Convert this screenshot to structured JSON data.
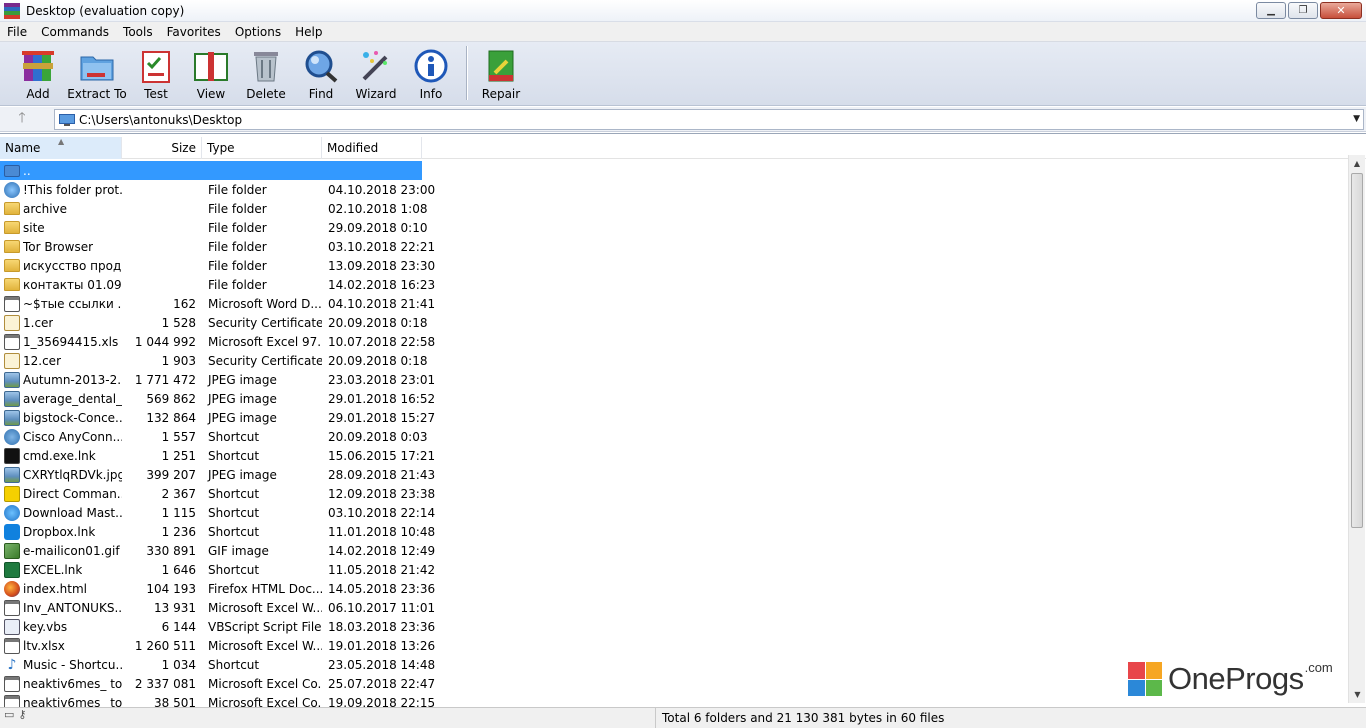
{
  "window": {
    "title": "Desktop (evaluation copy)"
  },
  "menu": [
    "File",
    "Commands",
    "Tools",
    "Favorites",
    "Options",
    "Help"
  ],
  "toolbar": [
    {
      "label": "Add",
      "icon": "add-icon"
    },
    {
      "label": "Extract To",
      "icon": "extract-icon"
    },
    {
      "label": "Test",
      "icon": "test-icon"
    },
    {
      "label": "View",
      "icon": "view-icon"
    },
    {
      "label": "Delete",
      "icon": "delete-icon"
    },
    {
      "label": "Find",
      "icon": "find-icon"
    },
    {
      "label": "Wizard",
      "icon": "wizard-icon"
    },
    {
      "label": "Info",
      "icon": "info-icon"
    },
    {
      "label": "Repair",
      "icon": "repair-icon"
    }
  ],
  "address": {
    "path": "C:\\Users\\antonuks\\Desktop"
  },
  "columns": {
    "name": "Name",
    "size": "Size",
    "type": "Type",
    "modified": "Modified"
  },
  "files": [
    {
      "name": "..",
      "size": "",
      "type": "",
      "modified": "",
      "icon": "up"
    },
    {
      "name": "!This folder prot...",
      "size": "",
      "type": "File folder",
      "modified": "04.10.2018 23:00",
      "icon": "shield"
    },
    {
      "name": "archive",
      "size": "",
      "type": "File folder",
      "modified": "02.10.2018 1:08",
      "icon": "folder"
    },
    {
      "name": "site",
      "size": "",
      "type": "File folder",
      "modified": "29.09.2018 0:10",
      "icon": "folder"
    },
    {
      "name": "Tor Browser",
      "size": "",
      "type": "File folder",
      "modified": "03.10.2018 22:21",
      "icon": "folder"
    },
    {
      "name": "искусство прод...",
      "size": "",
      "type": "File folder",
      "modified": "13.09.2018 23:30",
      "icon": "folder"
    },
    {
      "name": "контакты 01.09....",
      "size": "",
      "type": "File folder",
      "modified": "14.02.2018 16:23",
      "icon": "folder"
    },
    {
      "name": "~$тые ссылки ...",
      "size": "162",
      "type": "Microsoft Word D...",
      "modified": "04.10.2018 21:41",
      "icon": "doc"
    },
    {
      "name": "1.cer",
      "size": "1 528",
      "type": "Security Certificate",
      "modified": "20.09.2018 0:18",
      "icon": "cert"
    },
    {
      "name": "1_35694415.xls",
      "size": "1 044 992",
      "type": "Microsoft Excel 97...",
      "modified": "10.07.2018 22:58",
      "icon": "doc"
    },
    {
      "name": "12.cer",
      "size": "1 903",
      "type": "Security Certificate",
      "modified": "20.09.2018 0:18",
      "icon": "cert"
    },
    {
      "name": "Autumn-2013-2...",
      "size": "1 771 472",
      "type": "JPEG image",
      "modified": "23.03.2018 23:01",
      "icon": "img"
    },
    {
      "name": "average_dental_...",
      "size": "569 862",
      "type": "JPEG image",
      "modified": "29.01.2018 16:52",
      "icon": "img"
    },
    {
      "name": "bigstock-Conce...",
      "size": "132 864",
      "type": "JPEG image",
      "modified": "29.01.2018 15:27",
      "icon": "img"
    },
    {
      "name": "Cisco AnyConn...",
      "size": "1 557",
      "type": "Shortcut",
      "modified": "20.09.2018 0:03",
      "icon": "link"
    },
    {
      "name": "cmd.exe.lnk",
      "size": "1 251",
      "type": "Shortcut",
      "modified": "15.06.2015 17:21",
      "icon": "cmd"
    },
    {
      "name": "CXRYtlqRDVk.jpg",
      "size": "399 207",
      "type": "JPEG image",
      "modified": "28.09.2018 21:43",
      "icon": "img"
    },
    {
      "name": "Direct Comman...",
      "size": "2 367",
      "type": "Shortcut",
      "modified": "12.09.2018 23:38",
      "icon": "dc"
    },
    {
      "name": "Download Mast...",
      "size": "1 115",
      "type": "Shortcut",
      "modified": "03.10.2018 22:14",
      "icon": "dm"
    },
    {
      "name": "Dropbox.lnk",
      "size": "1 236",
      "type": "Shortcut",
      "modified": "11.01.2018 10:48",
      "icon": "dbx"
    },
    {
      "name": "e-mailicon01.gif",
      "size": "330 891",
      "type": "GIF image",
      "modified": "14.02.2018 12:49",
      "icon": "gif"
    },
    {
      "name": "EXCEL.lnk",
      "size": "1 646",
      "type": "Shortcut",
      "modified": "11.05.2018 21:42",
      "icon": "xls"
    },
    {
      "name": "index.html",
      "size": "104 193",
      "type": "Firefox HTML Doc...",
      "modified": "14.05.2018 23:36",
      "icon": "ff"
    },
    {
      "name": "Inv_ANTONUKS....",
      "size": "13 931",
      "type": "Microsoft Excel W...",
      "modified": "06.10.2017 11:01",
      "icon": "doc"
    },
    {
      "name": "key.vbs",
      "size": "6 144",
      "type": "VBScript Script File",
      "modified": "18.03.2018 23:36",
      "icon": "vbs"
    },
    {
      "name": "ltv.xlsx",
      "size": "1 260 511",
      "type": "Microsoft Excel W...",
      "modified": "19.01.2018 13:26",
      "icon": "doc"
    },
    {
      "name": "Music - Shortcu...",
      "size": "1 034",
      "type": "Shortcut",
      "modified": "23.05.2018 14:48",
      "icon": "mus"
    },
    {
      "name": "neaktiv6mes_ to...",
      "size": "2 337 081",
      "type": "Microsoft Excel Co...",
      "modified": "25.07.2018 22:47",
      "icon": "doc"
    },
    {
      "name": "neaktiv6mes_ to...",
      "size": "38 501",
      "type": "Microsoft Excel Co...",
      "modified": "19.09.2018 22:15",
      "icon": "doc"
    }
  ],
  "status": {
    "text": "Total 6 folders and 21 130 381 bytes in 60 files"
  },
  "watermark": {
    "text": "OneProgs",
    "sup": ".com"
  }
}
